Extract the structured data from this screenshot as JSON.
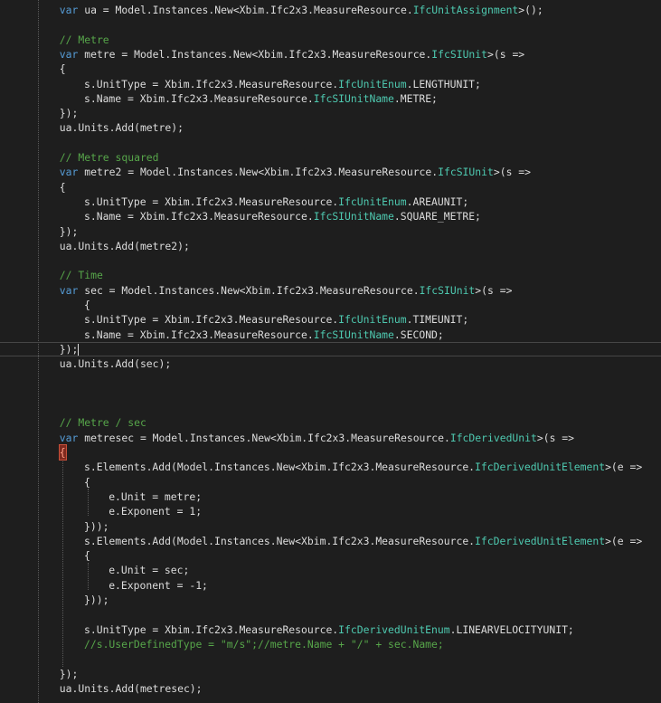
{
  "editor": {
    "colors": {
      "background": "#1e1e1e",
      "keyword": "#569cd6",
      "type": "#4ec9b0",
      "comment": "#57a64a",
      "string": "#d69d85",
      "text": "#dcdcdc",
      "brace_highlight": "#7f2a1f"
    },
    "lines": [
      {
        "indent": 16,
        "tokens": [
          {
            "t": "kw",
            "v": "var"
          },
          {
            "t": "pl",
            "v": " ua = Model.Instances.New<Xbim.Ifc2x3.MeasureResource."
          },
          {
            "t": "ty",
            "v": "IfcUnitAssignment"
          },
          {
            "t": "pl",
            "v": ">();"
          }
        ]
      },
      {
        "indent": 0,
        "tokens": []
      },
      {
        "indent": 16,
        "tokens": [
          {
            "t": "cm",
            "v": "// Metre"
          }
        ]
      },
      {
        "indent": 16,
        "tokens": [
          {
            "t": "kw",
            "v": "var"
          },
          {
            "t": "pl",
            "v": " metre = Model.Instances.New<Xbim.Ifc2x3.MeasureResource."
          },
          {
            "t": "ty",
            "v": "IfcSIUnit"
          },
          {
            "t": "pl",
            "v": ">(s =>"
          }
        ]
      },
      {
        "indent": 16,
        "tokens": [
          {
            "t": "pl",
            "v": "{"
          }
        ]
      },
      {
        "indent": 20,
        "tokens": [
          {
            "t": "pl",
            "v": "s.UnitType = Xbim.Ifc2x3.MeasureResource."
          },
          {
            "t": "ty",
            "v": "IfcUnitEnum"
          },
          {
            "t": "pl",
            "v": ".LENGTHUNIT;"
          }
        ]
      },
      {
        "indent": 20,
        "tokens": [
          {
            "t": "pl",
            "v": "s.Name = Xbim.Ifc2x3.MeasureResource."
          },
          {
            "t": "ty",
            "v": "IfcSIUnitName"
          },
          {
            "t": "pl",
            "v": ".METRE;"
          }
        ]
      },
      {
        "indent": 16,
        "tokens": [
          {
            "t": "pl",
            "v": "});"
          }
        ]
      },
      {
        "indent": 16,
        "tokens": [
          {
            "t": "pl",
            "v": "ua.Units.Add(metre);"
          }
        ]
      },
      {
        "indent": 0,
        "tokens": []
      },
      {
        "indent": 16,
        "tokens": [
          {
            "t": "cm",
            "v": "// Metre squared"
          }
        ]
      },
      {
        "indent": 16,
        "tokens": [
          {
            "t": "kw",
            "v": "var"
          },
          {
            "t": "pl",
            "v": " metre2 = Model.Instances.New<Xbim.Ifc2x3.MeasureResource."
          },
          {
            "t": "ty",
            "v": "IfcSIUnit"
          },
          {
            "t": "pl",
            "v": ">(s =>"
          }
        ]
      },
      {
        "indent": 16,
        "tokens": [
          {
            "t": "pl",
            "v": "{"
          }
        ]
      },
      {
        "indent": 20,
        "tokens": [
          {
            "t": "pl",
            "v": "s.UnitType = Xbim.Ifc2x3.MeasureResource."
          },
          {
            "t": "ty",
            "v": "IfcUnitEnum"
          },
          {
            "t": "pl",
            "v": ".AREAUNIT;"
          }
        ]
      },
      {
        "indent": 20,
        "tokens": [
          {
            "t": "pl",
            "v": "s.Name = Xbim.Ifc2x3.MeasureResource."
          },
          {
            "t": "ty",
            "v": "IfcSIUnitName"
          },
          {
            "t": "pl",
            "v": ".SQUARE_METRE;"
          }
        ]
      },
      {
        "indent": 16,
        "tokens": [
          {
            "t": "pl",
            "v": "});"
          }
        ]
      },
      {
        "indent": 16,
        "tokens": [
          {
            "t": "pl",
            "v": "ua.Units.Add(metre2);"
          }
        ]
      },
      {
        "indent": 0,
        "tokens": []
      },
      {
        "indent": 16,
        "tokens": [
          {
            "t": "cm",
            "v": "// Time"
          }
        ]
      },
      {
        "indent": 16,
        "tokens": [
          {
            "t": "kw",
            "v": "var"
          },
          {
            "t": "pl",
            "v": " sec = Model.Instances.New<Xbim.Ifc2x3.MeasureResource."
          },
          {
            "t": "ty",
            "v": "IfcSIUnit"
          },
          {
            "t": "pl",
            "v": ">(s =>"
          }
        ]
      },
      {
        "indent": 20,
        "tokens": [
          {
            "t": "pl",
            "v": "{"
          }
        ]
      },
      {
        "indent": 20,
        "tokens": [
          {
            "t": "pl",
            "v": "s.UnitType = Xbim.Ifc2x3.MeasureResource."
          },
          {
            "t": "ty",
            "v": "IfcUnitEnum"
          },
          {
            "t": "pl",
            "v": ".TIMEUNIT;"
          }
        ]
      },
      {
        "indent": 20,
        "tokens": [
          {
            "t": "pl",
            "v": "s.Name = Xbim.Ifc2x3.MeasureResource."
          },
          {
            "t": "ty",
            "v": "IfcSIUnitName"
          },
          {
            "t": "pl",
            "v": ".SECOND;"
          }
        ]
      },
      {
        "indent": 16,
        "current": true,
        "tokens": [
          {
            "t": "pl",
            "v": "});"
          }
        ]
      },
      {
        "indent": 16,
        "tokens": [
          {
            "t": "pl",
            "v": "ua.Units.Add(sec);"
          }
        ]
      },
      {
        "indent": 0,
        "tokens": []
      },
      {
        "indent": 0,
        "tokens": []
      },
      {
        "indent": 0,
        "tokens": []
      },
      {
        "indent": 16,
        "tokens": [
          {
            "t": "cm",
            "v": "// Metre / sec"
          }
        ]
      },
      {
        "indent": 16,
        "tokens": [
          {
            "t": "kw",
            "v": "var"
          },
          {
            "t": "pl",
            "v": " metresec = Model.Instances.New<Xbim.Ifc2x3.MeasureResource."
          },
          {
            "t": "ty",
            "v": "IfcDerivedUnit"
          },
          {
            "t": "pl",
            "v": ">(s =>"
          }
        ]
      },
      {
        "indent": 16,
        "tokens": [
          {
            "t": "hl",
            "v": "{"
          }
        ]
      },
      {
        "indent": 20,
        "tokens": [
          {
            "t": "pl",
            "v": "s.Elements.Add(Model.Instances.New<Xbim.Ifc2x3.MeasureResource."
          },
          {
            "t": "ty",
            "v": "IfcDerivedUnitElement"
          },
          {
            "t": "pl",
            "v": ">(e =>"
          }
        ]
      },
      {
        "indent": 20,
        "tokens": [
          {
            "t": "pl",
            "v": "{"
          }
        ]
      },
      {
        "indent": 24,
        "tokens": [
          {
            "t": "pl",
            "v": "e.Unit = metre;"
          }
        ]
      },
      {
        "indent": 24,
        "tokens": [
          {
            "t": "pl",
            "v": "e.Exponent = 1;"
          }
        ]
      },
      {
        "indent": 20,
        "tokens": [
          {
            "t": "pl",
            "v": "}));"
          }
        ]
      },
      {
        "indent": 20,
        "tokens": [
          {
            "t": "pl",
            "v": "s.Elements.Add(Model.Instances.New<Xbim.Ifc2x3.MeasureResource."
          },
          {
            "t": "ty",
            "v": "IfcDerivedUnitElement"
          },
          {
            "t": "pl",
            "v": ">(e =>"
          }
        ]
      },
      {
        "indent": 20,
        "tokens": [
          {
            "t": "pl",
            "v": "{"
          }
        ]
      },
      {
        "indent": 24,
        "tokens": [
          {
            "t": "pl",
            "v": "e.Unit = sec;"
          }
        ]
      },
      {
        "indent": 24,
        "tokens": [
          {
            "t": "pl",
            "v": "e.Exponent = -1;"
          }
        ]
      },
      {
        "indent": 20,
        "tokens": [
          {
            "t": "pl",
            "v": "}));"
          }
        ]
      },
      {
        "indent": 0,
        "tokens": []
      },
      {
        "indent": 20,
        "tokens": [
          {
            "t": "pl",
            "v": "s.UnitType = Xbim.Ifc2x3.MeasureResource."
          },
          {
            "t": "ty",
            "v": "IfcDerivedUnitEnum"
          },
          {
            "t": "pl",
            "v": ".LINEARVELOCITYUNIT;"
          }
        ]
      },
      {
        "indent": 20,
        "tokens": [
          {
            "t": "cm",
            "v": "//s.UserDefinedType = \"m/s\";//metre.Name + \"/\" + sec.Name;"
          }
        ]
      },
      {
        "indent": 0,
        "tokens": []
      },
      {
        "indent": 16,
        "tokens": [
          {
            "t": "pl",
            "v": "});"
          }
        ]
      },
      {
        "indent": 16,
        "tokens": [
          {
            "t": "pl",
            "v": "ua.Units.Add(metresec);"
          }
        ]
      }
    ]
  }
}
